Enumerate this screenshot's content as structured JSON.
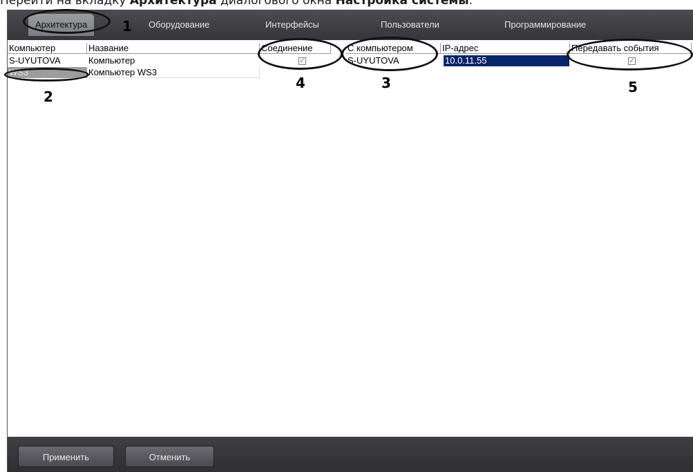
{
  "caption": {
    "prefix": "Перейти на вкладку ",
    "tab_name": "Архитектура",
    "middle": " диалогового окна ",
    "dialog_name": "Настройка системы",
    "suffix": "."
  },
  "tabs": [
    {
      "label": "Архитектура",
      "active": true
    },
    {
      "label": "Оборудование",
      "active": false
    },
    {
      "label": "Интерфейсы",
      "active": false
    },
    {
      "label": "Пользователи",
      "active": false
    },
    {
      "label": "Программирование",
      "active": false
    }
  ],
  "table": {
    "columns": [
      "Компьютер",
      "Название",
      "Соединение",
      "С компьютером",
      "IP-адрес",
      "Передавать события"
    ],
    "rows": [
      {
        "computer": "S-UYUTOVA",
        "name": "Компьютер",
        "connection": true,
        "with_computer": "S-UYUTOVA",
        "ip": "10.0.11.55",
        "send_events": true
      },
      {
        "computer": "WS3",
        "name": "Компьютер WS3"
      }
    ]
  },
  "annotations": [
    "1",
    "2",
    "3",
    "4",
    "5"
  ],
  "buttons": {
    "apply": "Применить",
    "cancel": "Отменить"
  },
  "icons": {
    "checked": "✓"
  },
  "colors": {
    "tabbar": "#3f3f44",
    "selection": "#0a246a"
  }
}
